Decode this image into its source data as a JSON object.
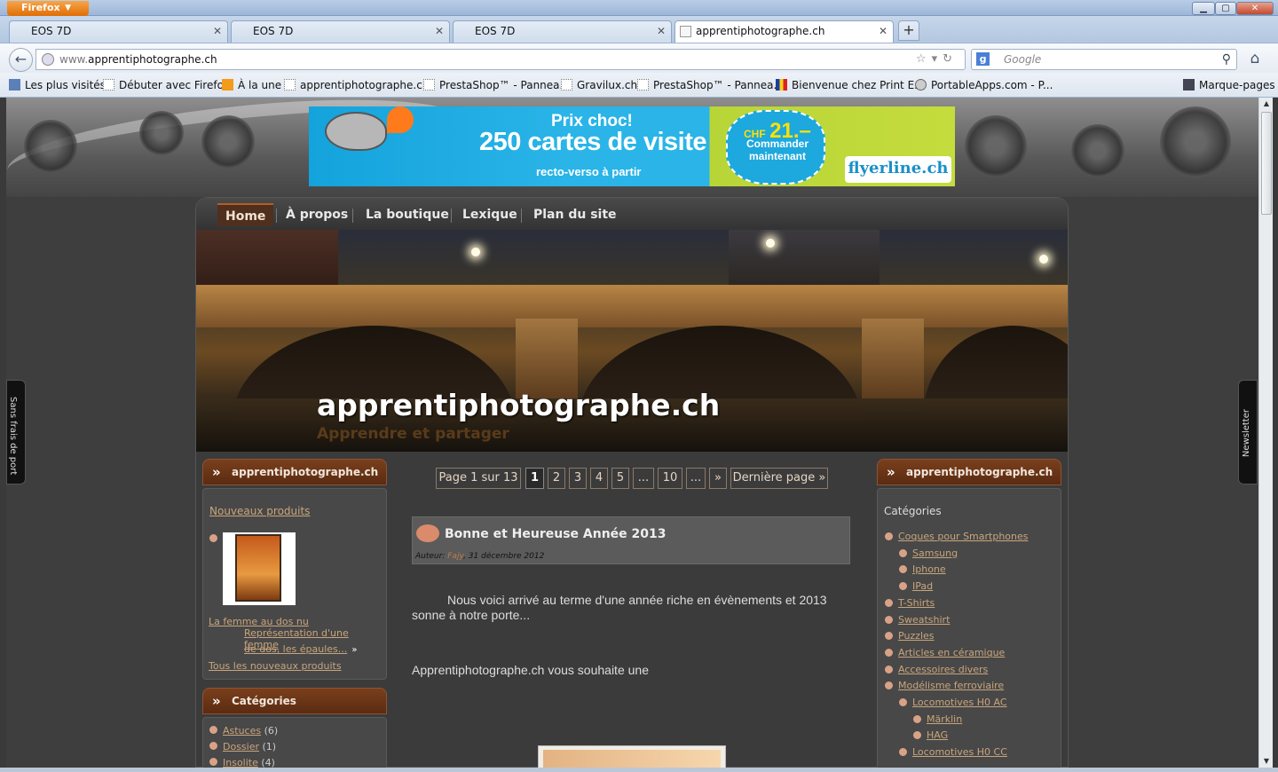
{
  "window": {
    "button": "Firefox",
    "min": "▁",
    "max": "▢",
    "close": "✕"
  },
  "tabs": [
    {
      "label": "EOS 7D"
    },
    {
      "label": "EOS 7D"
    },
    {
      "label": "EOS 7D"
    },
    {
      "label": "apprentiphotographe.ch"
    }
  ],
  "nav": {
    "url_prefix": "www.",
    "url_domain": "apprentiphotographe.ch",
    "search_placeholder": "Google"
  },
  "bookmarks": [
    "Les plus visités",
    "Débuter avec Firefox",
    "À la une",
    "apprentiphotographe.ch",
    "PrestaShop™ - Pannea...",
    "Gravilux.ch",
    "PrestaShop™ - Pannea...",
    "Bienvenue chez Print E...",
    "PortableApps.com - P...",
    "Marque-pages"
  ],
  "banner": {
    "line1": "Prix choc!",
    "line2": "250 cartes de visite",
    "line3": "recto-verso à partir",
    "currency": "CHF",
    "price": "21.–",
    "cta1": "Commander",
    "cta2": "maintenant",
    "brand": "flyerline.ch"
  },
  "menu": [
    "Home",
    "À propos",
    "La boutique",
    "Lexique",
    "Plan du site"
  ],
  "site": {
    "title": "apprentiphotographe.ch",
    "tagline": "Apprendre et partager"
  },
  "left": {
    "shop_title": "apprentiphotographe.ch Shop",
    "new_products": "Nouveaux produits",
    "product_name": "La femme au dos nu",
    "product_desc1": "Représentation d'une femme",
    "product_desc2": "de dos, les épaules...",
    "all_new": "Tous les nouveaux produits",
    "cat_title": "Catégories",
    "cats": [
      {
        "name": "Astuces",
        "count": "(6)"
      },
      {
        "name": "Dossier",
        "count": "(1)"
      },
      {
        "name": "Insolite",
        "count": "(4)"
      }
    ]
  },
  "pagination": {
    "label": "Page 1 sur 13",
    "pages": [
      "1",
      "2",
      "3",
      "4",
      "5",
      "...",
      "10",
      "...",
      "»"
    ],
    "last": "Dernière page »"
  },
  "post": {
    "title": "Bonne et Heureuse Année 2013",
    "author_label": "Auteur:",
    "author": "Fajy",
    "date": ", 31 décembre 2012",
    "p1": "Nous voici arrivé au terme d'une année riche en évènements et 2013 sonne à notre porte...",
    "p2": "Apprentiphotographe.ch vous souhaite une"
  },
  "right": {
    "shop_title": "apprentiphotographe.ch Shop",
    "cat_title": "Catégories",
    "cats": [
      {
        "name": "Coques pour Smartphones",
        "level": 0
      },
      {
        "name": "Samsung",
        "level": 1
      },
      {
        "name": "Iphone",
        "level": 1
      },
      {
        "name": "IPad",
        "level": 1
      },
      {
        "name": "T-Shirts",
        "level": 0
      },
      {
        "name": "Sweatshirt",
        "level": 0
      },
      {
        "name": "Puzzles",
        "level": 0
      },
      {
        "name": "Articles en céramique",
        "level": 0
      },
      {
        "name": "Accessoires divers",
        "level": 0
      },
      {
        "name": "Modélisme ferroviaire",
        "level": 0
      },
      {
        "name": "Locomotives H0 AC",
        "level": 1
      },
      {
        "name": "Märklin",
        "level": 2
      },
      {
        "name": "HAG",
        "level": 2
      },
      {
        "name": "Locomotives H0 CC",
        "level": 1
      }
    ]
  },
  "sidetabs": {
    "left": "Sans frais de port",
    "right": "Newsletter"
  }
}
